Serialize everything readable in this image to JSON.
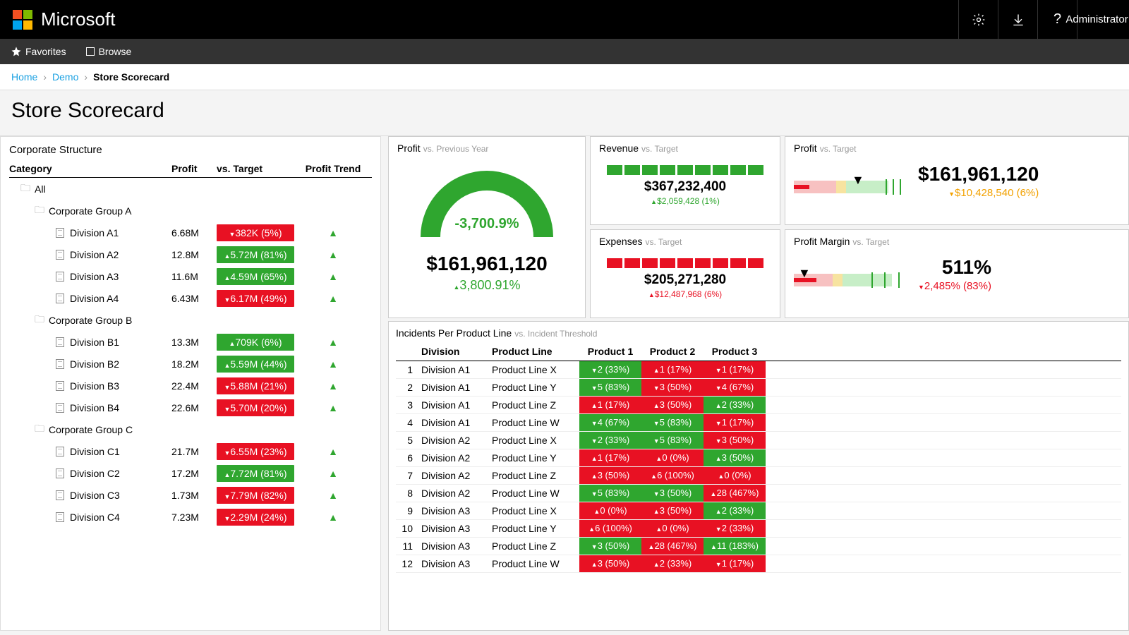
{
  "brand": "Microsoft",
  "user": "Administrator",
  "nav": {
    "favorites": "Favorites",
    "browse": "Browse"
  },
  "crumbs": {
    "home": "Home",
    "demo": "Demo",
    "current": "Store Scorecard"
  },
  "page_title": "Store Scorecard",
  "tree": {
    "title": "Corporate Structure",
    "headers": {
      "category": "Category",
      "profit": "Profit",
      "target": "vs. Target",
      "trend": "Profit Trend"
    },
    "all": "All",
    "groups": [
      {
        "name": "Corporate Group A",
        "rows": [
          {
            "name": "Division A1",
            "profit": "6.68M",
            "target": "382K (5%)",
            "dir": "down",
            "color": "red"
          },
          {
            "name": "Division A2",
            "profit": "12.8M",
            "target": "5.72M (81%)",
            "dir": "up",
            "color": "green"
          },
          {
            "name": "Division A3",
            "profit": "11.6M",
            "target": "4.59M (65%)",
            "dir": "up",
            "color": "green"
          },
          {
            "name": "Division A4",
            "profit": "6.43M",
            "target": "6.17M (49%)",
            "dir": "down",
            "color": "red"
          }
        ]
      },
      {
        "name": "Corporate Group B",
        "rows": [
          {
            "name": "Division B1",
            "profit": "13.3M",
            "target": "709K (6%)",
            "dir": "up",
            "color": "green"
          },
          {
            "name": "Division B2",
            "profit": "18.2M",
            "target": "5.59M (44%)",
            "dir": "up",
            "color": "green"
          },
          {
            "name": "Division B3",
            "profit": "22.4M",
            "target": "5.88M (21%)",
            "dir": "down",
            "color": "red"
          },
          {
            "name": "Division B4",
            "profit": "22.6M",
            "target": "5.70M (20%)",
            "dir": "down",
            "color": "red"
          }
        ]
      },
      {
        "name": "Corporate Group C",
        "rows": [
          {
            "name": "Division C1",
            "profit": "21.7M",
            "target": "6.55M (23%)",
            "dir": "down",
            "color": "red"
          },
          {
            "name": "Division C2",
            "profit": "17.2M",
            "target": "7.72M (81%)",
            "dir": "up",
            "color": "green"
          },
          {
            "name": "Division C3",
            "profit": "1.73M",
            "target": "7.79M (82%)",
            "dir": "down",
            "color": "red"
          },
          {
            "name": "Division C4",
            "profit": "7.23M",
            "target": "2.29M (24%)",
            "dir": "down",
            "color": "red"
          }
        ]
      }
    ]
  },
  "cards": {
    "profit_prev": {
      "title": "Profit",
      "sub": "vs. Previous Year",
      "pct": "-3,700.9%",
      "value": "$161,961,120",
      "delta": "3,800.91%"
    },
    "revenue": {
      "title": "Revenue",
      "sub": "vs. Target",
      "value": "$367,232,400",
      "delta": "$2,059,428 (1%)",
      "ok": true
    },
    "expenses": {
      "title": "Expenses",
      "sub": "vs. Target",
      "value": "$205,271,280",
      "delta": "$12,487,968 (6%)",
      "ok": false
    },
    "profit_tgt": {
      "title": "Profit",
      "sub": "vs. Target",
      "value": "$161,961,120",
      "delta": "$10,428,540 (6%)"
    },
    "margin": {
      "title": "Profit Margin",
      "sub": "vs. Target",
      "value": "511%",
      "delta": "2,485% (83%)"
    }
  },
  "incidents": {
    "title": "Incidents Per Product Line",
    "sub": "vs. Incident Threshold",
    "headers": {
      "div": "Division",
      "pl": "Product Line",
      "p1": "Product 1",
      "p2": "Product 2",
      "p3": "Product 3"
    },
    "rows": [
      {
        "n": 1,
        "div": "Division A1",
        "pl": "Product Line X",
        "c": [
          {
            "t": "2 (33%)",
            "d": "down",
            "g": 1
          },
          {
            "t": "1 (17%)",
            "d": "up",
            "g": 0
          },
          {
            "t": "1 (17%)",
            "d": "down",
            "g": 0
          }
        ]
      },
      {
        "n": 2,
        "div": "Division A1",
        "pl": "Product Line Y",
        "c": [
          {
            "t": "5 (83%)",
            "d": "down",
            "g": 1
          },
          {
            "t": "3 (50%)",
            "d": "down",
            "g": 0
          },
          {
            "t": "4 (67%)",
            "d": "down",
            "g": 0
          }
        ]
      },
      {
        "n": 3,
        "div": "Division A1",
        "pl": "Product Line Z",
        "c": [
          {
            "t": "1 (17%)",
            "d": "up",
            "g": 0
          },
          {
            "t": "3 (50%)",
            "d": "up",
            "g": 0
          },
          {
            "t": "2 (33%)",
            "d": "up",
            "g": 1
          }
        ]
      },
      {
        "n": 4,
        "div": "Division A1",
        "pl": "Product Line W",
        "c": [
          {
            "t": "4 (67%)",
            "d": "down",
            "g": 1
          },
          {
            "t": "5 (83%)",
            "d": "down",
            "g": 1
          },
          {
            "t": "1 (17%)",
            "d": "down",
            "g": 0
          }
        ]
      },
      {
        "n": 5,
        "div": "Division A2",
        "pl": "Product Line X",
        "c": [
          {
            "t": "2 (33%)",
            "d": "down",
            "g": 1
          },
          {
            "t": "5 (83%)",
            "d": "down",
            "g": 1
          },
          {
            "t": "3 (50%)",
            "d": "down",
            "g": 0
          }
        ]
      },
      {
        "n": 6,
        "div": "Division A2",
        "pl": "Product Line Y",
        "c": [
          {
            "t": "1 (17%)",
            "d": "up",
            "g": 0
          },
          {
            "t": "0 (0%)",
            "d": "up",
            "g": 0
          },
          {
            "t": "3 (50%)",
            "d": "up",
            "g": 1
          }
        ]
      },
      {
        "n": 7,
        "div": "Division A2",
        "pl": "Product Line Z",
        "c": [
          {
            "t": "3 (50%)",
            "d": "up",
            "g": 0
          },
          {
            "t": "6 (100%)",
            "d": "up",
            "g": 0
          },
          {
            "t": "0 (0%)",
            "d": "up",
            "g": 0
          }
        ]
      },
      {
        "n": 8,
        "div": "Division A2",
        "pl": "Product Line W",
        "c": [
          {
            "t": "5 (83%)",
            "d": "down",
            "g": 1
          },
          {
            "t": "3 (50%)",
            "d": "down",
            "g": 1
          },
          {
            "t": "28 (467%)",
            "d": "up",
            "g": 0
          }
        ]
      },
      {
        "n": 9,
        "div": "Division A3",
        "pl": "Product Line X",
        "c": [
          {
            "t": "0 (0%)",
            "d": "up",
            "g": 0
          },
          {
            "t": "3 (50%)",
            "d": "up",
            "g": 0
          },
          {
            "t": "2 (33%)",
            "d": "up",
            "g": 1
          }
        ]
      },
      {
        "n": 10,
        "div": "Division A3",
        "pl": "Product Line Y",
        "c": [
          {
            "t": "6 (100%)",
            "d": "up",
            "g": 0
          },
          {
            "t": "0 (0%)",
            "d": "up",
            "g": 0
          },
          {
            "t": "2 (33%)",
            "d": "down",
            "g": 0
          }
        ]
      },
      {
        "n": 11,
        "div": "Division A3",
        "pl": "Product Line Z",
        "c": [
          {
            "t": "3 (50%)",
            "d": "down",
            "g": 1
          },
          {
            "t": "28 (467%)",
            "d": "up",
            "g": 0
          },
          {
            "t": "11 (183%)",
            "d": "up",
            "g": 1
          }
        ]
      },
      {
        "n": 12,
        "div": "Division A3",
        "pl": "Product Line W",
        "c": [
          {
            "t": "3 (50%)",
            "d": "up",
            "g": 0
          },
          {
            "t": "2 (33%)",
            "d": "up",
            "g": 0
          },
          {
            "t": "1 (17%)",
            "d": "down",
            "g": 0
          }
        ]
      }
    ]
  },
  "chart_data": {
    "gauge": {
      "type": "gauge",
      "title": "Profit vs. Previous Year",
      "value": 161961120,
      "pct_change": 3800.91,
      "display_pct": -3700.9
    },
    "revenue_segments": {
      "type": "bar",
      "title": "Revenue vs. Target",
      "total": 367232400,
      "delta": 2059428,
      "delta_pct": 1,
      "segments": [
        1,
        1,
        1,
        1,
        1,
        1,
        1,
        1,
        1
      ],
      "seg_ok": true
    },
    "expense_segments": {
      "type": "bar",
      "title": "Expenses vs. Target",
      "total": 205271280,
      "delta": 12487968,
      "delta_pct": 6,
      "segments": [
        1,
        1,
        1,
        1,
        1,
        1,
        1,
        1,
        1
      ],
      "seg_ok": false
    },
    "profit_bullet": {
      "type": "bullet",
      "title": "Profit vs. Target",
      "value": 161961120,
      "delta": 10428540,
      "delta_pct": 6,
      "marker_pos": 0.55,
      "ranges": [
        0.38,
        0.47,
        0.85
      ],
      "ticks": [
        0.86,
        0.92,
        0.98
      ]
    },
    "margin_bullet": {
      "type": "bullet",
      "title": "Profit Margin vs. Target",
      "value_pct": 511,
      "delta_pct": 83,
      "delta_abs": 2485,
      "marker_pos": 0.08,
      "ranges": [
        0.35,
        0.44,
        0.8
      ],
      "ticks": [
        0.7,
        0.82,
        0.95
      ]
    }
  }
}
